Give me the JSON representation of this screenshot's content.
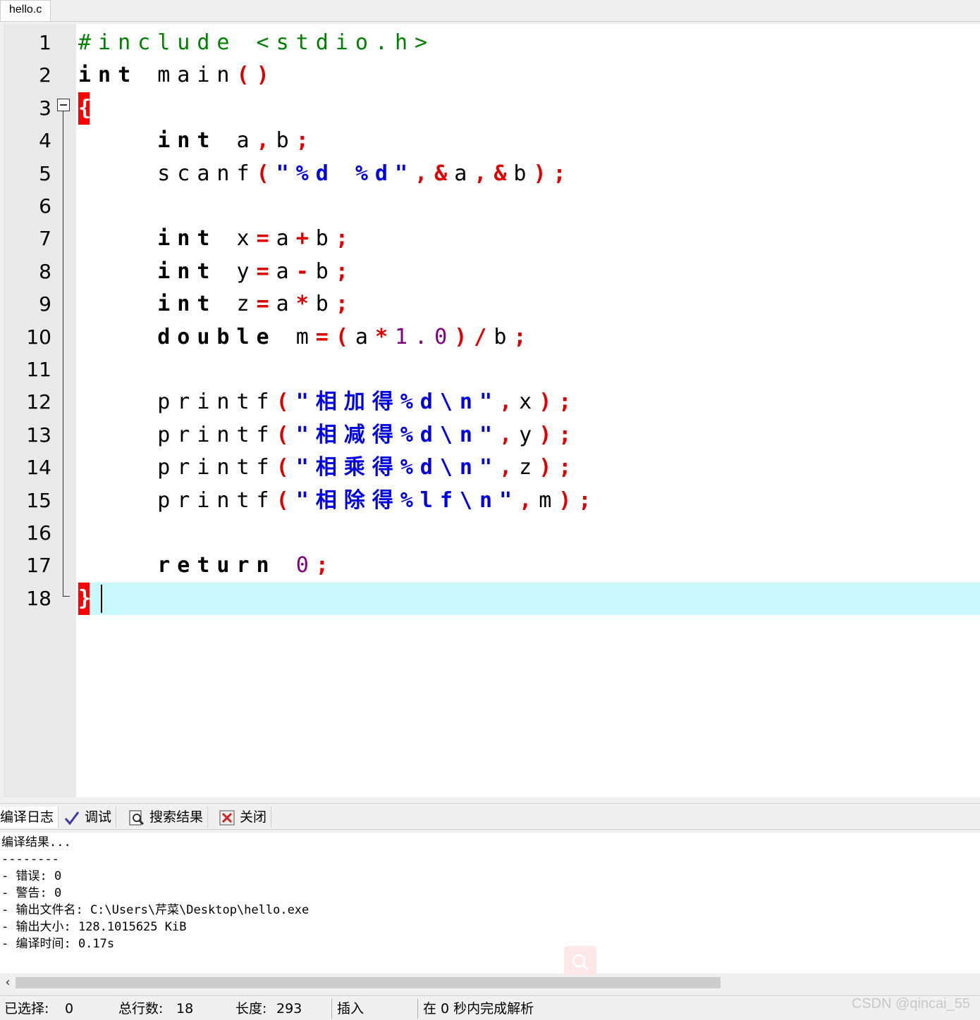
{
  "file_tab": "hello.c",
  "code_lines": [
    {
      "n": "1",
      "code": "#include <stdio.h>"
    },
    {
      "n": "2",
      "code": "int main()"
    },
    {
      "n": "3",
      "code": "{"
    },
    {
      "n": "4",
      "code": "    int a,b;"
    },
    {
      "n": "5",
      "code": "    scanf(\"%d %d\",&a,&b);"
    },
    {
      "n": "6",
      "code": ""
    },
    {
      "n": "7",
      "code": "    int x=a+b;"
    },
    {
      "n": "8",
      "code": "    int y=a-b;"
    },
    {
      "n": "9",
      "code": "    int z=a*b;"
    },
    {
      "n": "10",
      "code": "    double m=(a*1.0)/b;"
    },
    {
      "n": "11",
      "code": ""
    },
    {
      "n": "12",
      "code": "    printf(\"相加得%d\\n\",x);"
    },
    {
      "n": "13",
      "code": "    printf(\"相减得%d\\n\",y);"
    },
    {
      "n": "14",
      "code": "    printf(\"相乘得%d\\n\",z);"
    },
    {
      "n": "15",
      "code": "    printf(\"相除得%lf\\n\",m);"
    },
    {
      "n": "16",
      "code": ""
    },
    {
      "n": "17",
      "code": "    return 0;"
    },
    {
      "n": "18",
      "code": "}"
    }
  ],
  "panel_tabs": {
    "compile_log": "编译日志",
    "debug": "调试",
    "search_results": "搜索结果",
    "close": "关闭"
  },
  "compile_log": [
    "编译结果...",
    "--------",
    "- 错误: 0",
    "- 警告: 0",
    "- 输出文件名: C:\\Users\\芹菜\\Desktop\\hello.exe",
    "- 输出大小: 128.1015625 KiB",
    "- 编译时间: 0.17s"
  ],
  "status": {
    "selected_label": "已选择:",
    "selected_value": "0",
    "total_lines_label": "总行数:",
    "total_lines_value": "18",
    "length_label": "长度:",
    "length_value": "293",
    "mode": "插入",
    "parse": "在 0 秒内完成解析"
  },
  "watermark": "CSDN @qincai_55",
  "colors": {
    "keyword": "#000000",
    "operator": "#e00000",
    "string": "#0000e0",
    "number": "#800080",
    "preprocessor": "#008000",
    "current_line": "#c8fafd",
    "brace_match": "#ff0000"
  },
  "icons": [
    "fold-minus-icon",
    "debug-check-icon",
    "search-results-icon",
    "close-panel-icon",
    "search-icon",
    "scroll-left-icon"
  ]
}
